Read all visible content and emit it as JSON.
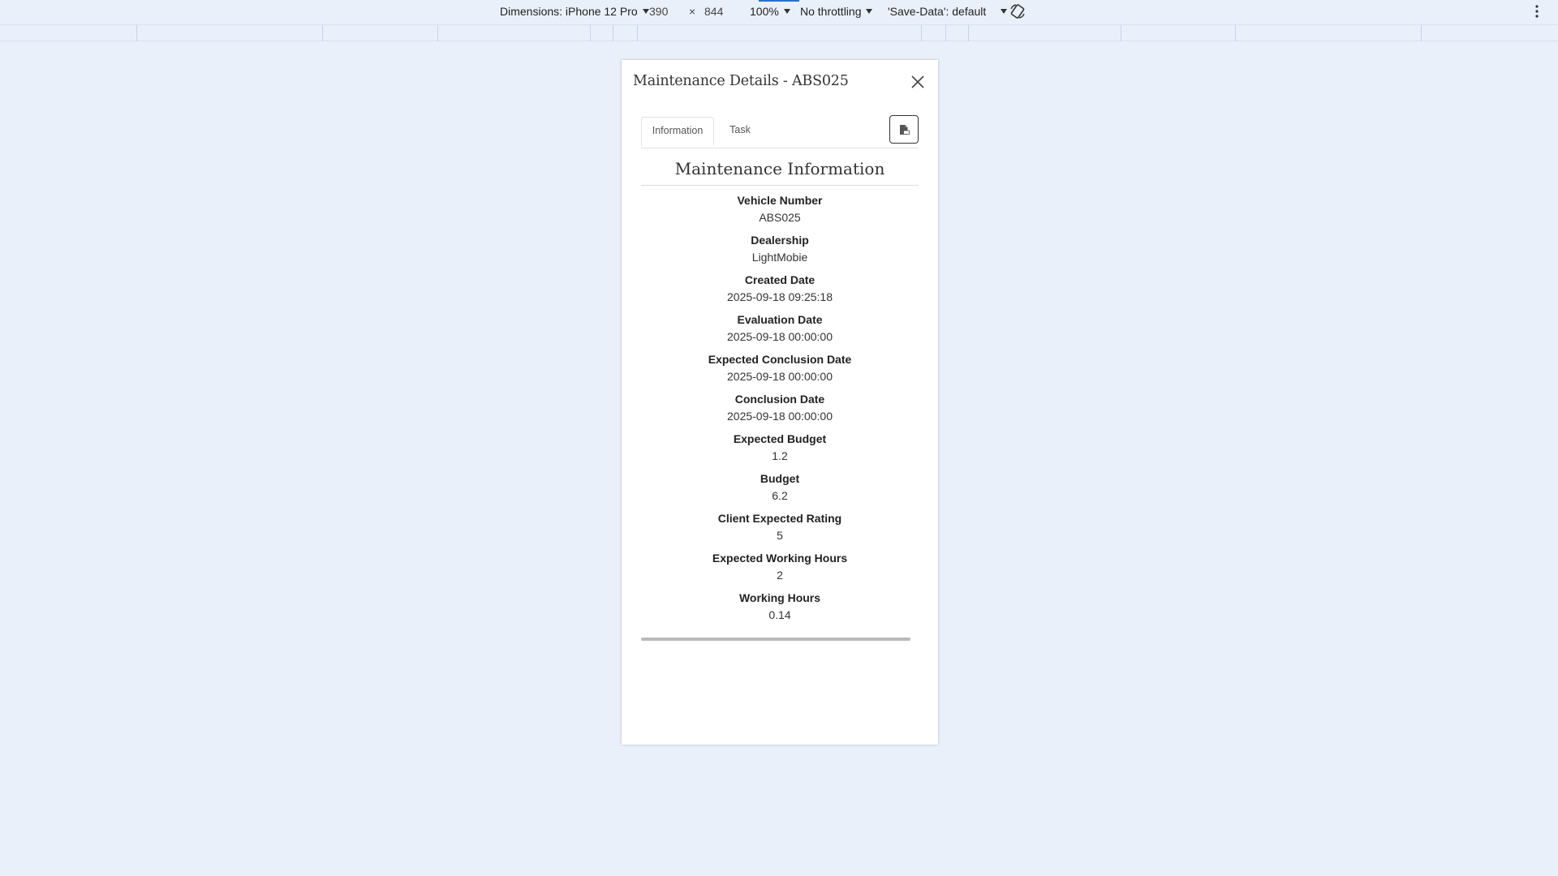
{
  "devtools": {
    "dimensions_label": "Dimensions: iPhone 12 Pro",
    "width": "390",
    "times": "×",
    "height": "844",
    "zoom": "100%",
    "throttling": "No throttling",
    "save_data": "'Save-Data': default"
  },
  "modal": {
    "title": "Maintenance Details - ABS025",
    "tabs": [
      {
        "label": "Information",
        "active": true
      },
      {
        "label": "Task",
        "active": false
      }
    ],
    "section_title": "Maintenance Information",
    "fields": [
      {
        "label": "Vehicle Number",
        "value": "ABS025"
      },
      {
        "label": "Dealership",
        "value": "LightMobie"
      },
      {
        "label": "Created Date",
        "value": "2025-09-18 09:25:18"
      },
      {
        "label": "Evaluation Date",
        "value": "2025-09-18 00:00:00"
      },
      {
        "label": "Expected Conclusion Date",
        "value": "2025-09-18 00:00:00"
      },
      {
        "label": "Conclusion Date",
        "value": "2025-09-18 00:00:00"
      },
      {
        "label": "Expected Budget",
        "value": "1.2"
      },
      {
        "label": "Budget",
        "value": "6.2"
      },
      {
        "label": "Client Expected Rating",
        "value": "5"
      },
      {
        "label": "Expected Working Hours",
        "value": "2"
      },
      {
        "label": "Working Hours",
        "value": "0.14"
      }
    ]
  },
  "icons": {
    "close": "close-icon",
    "pdf": "pdf-file-icon",
    "rotate": "rotate-icon",
    "more": "kebab-menu-icon"
  },
  "colors": {
    "page_background": "#eaf0fa",
    "accent": "#1a73e8"
  }
}
